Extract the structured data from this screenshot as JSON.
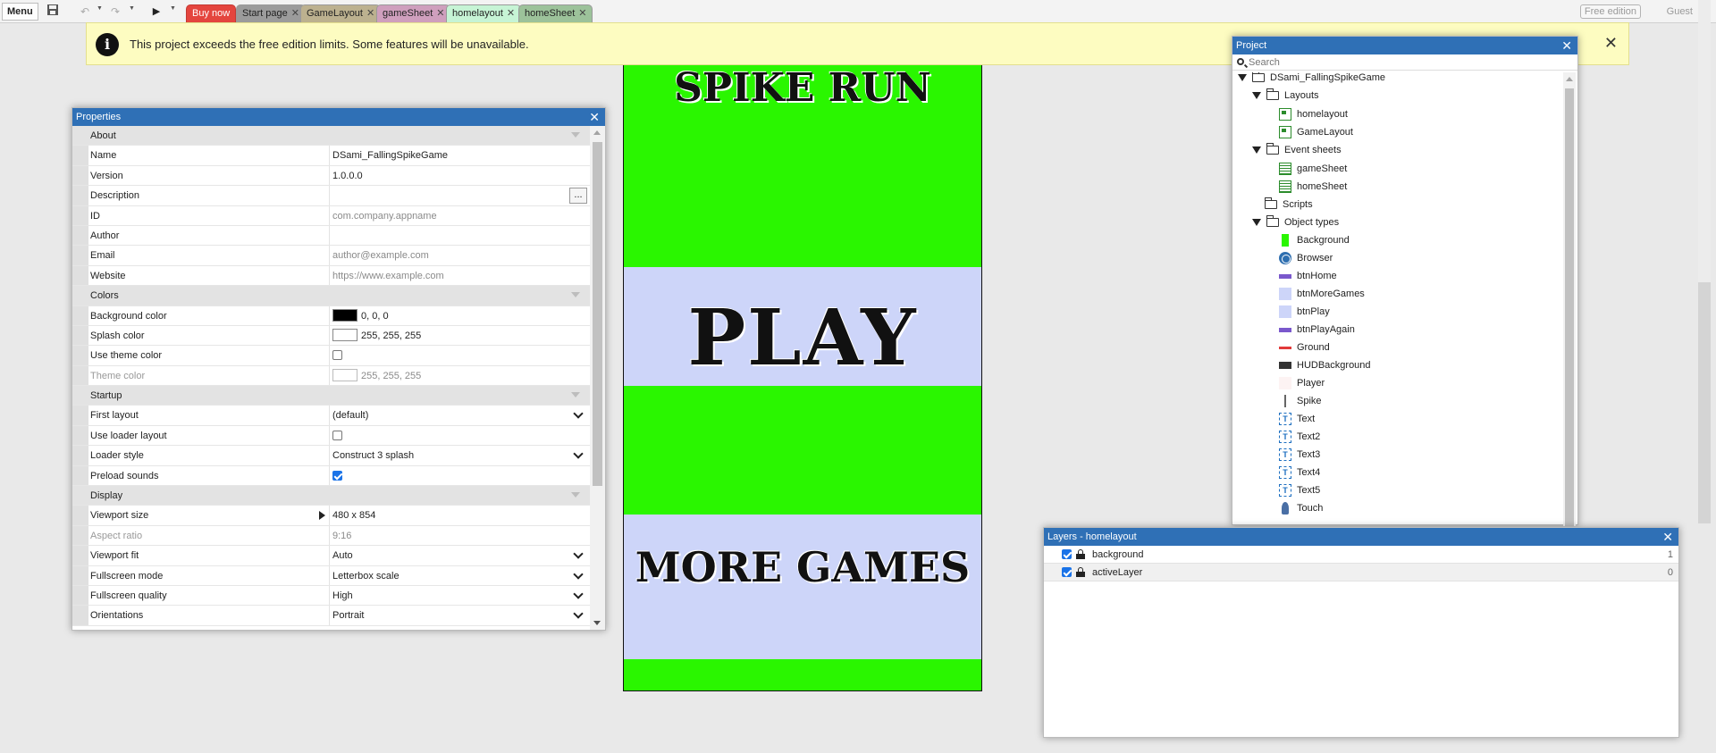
{
  "toolbar": {
    "menu_label": "Menu",
    "buy_now": "Buy now",
    "free_edition": "Free edition",
    "guest": "Guest"
  },
  "tabs": [
    {
      "label": "Start page",
      "bg": "#9b9b9b"
    },
    {
      "label": "GameLayout",
      "bg": "#bcb18f"
    },
    {
      "label": "gameSheet",
      "bg": "#cf9fbd"
    },
    {
      "label": "homelayout",
      "bg": "#c6f4d5"
    },
    {
      "label": "homeSheet",
      "bg": "#9cc29a"
    }
  ],
  "banner": {
    "text": "This project exceeds the free edition limits. Some features will be unavailable."
  },
  "canvas": {
    "title": "SPIKE RUN",
    "play": "PLAY",
    "more_games": "MORE GAMES",
    "green": "#2af600",
    "band": "#cdd5f9"
  },
  "properties": {
    "title": "Properties",
    "about": "About",
    "name_label": "Name",
    "name_value": "DSami_FallingSpikeGame",
    "version_label": "Version",
    "version_value": "1.0.0.0",
    "description_label": "Description",
    "description_button": "...",
    "id_label": "ID",
    "id_placeholder": "com.company.appname",
    "author_label": "Author",
    "email_label": "Email",
    "email_placeholder": "author@example.com",
    "website_label": "Website",
    "website_placeholder": "https://www.example.com",
    "colors": "Colors",
    "bg_color_label": "Background color",
    "bg_color_value": "0, 0, 0",
    "splash_color_label": "Splash color",
    "splash_color_value": "255, 255, 255",
    "use_theme_label": "Use theme color",
    "theme_color_label": "Theme color",
    "theme_color_value": "255, 255, 255",
    "startup": "Startup",
    "first_layout_label": "First layout",
    "first_layout_value": "(default)",
    "use_loader_label": "Use loader layout",
    "loader_style_label": "Loader style",
    "loader_style_value": "Construct 3 splash",
    "preload_label": "Preload sounds",
    "display": "Display",
    "viewport_size_label": "Viewport size",
    "viewport_size_value": "480 x 854",
    "aspect_label": "Aspect ratio",
    "aspect_value": "9:16",
    "viewport_fit_label": "Viewport fit",
    "viewport_fit_value": "Auto",
    "fullscreen_mode_label": "Fullscreen mode",
    "fullscreen_mode_value": "Letterbox scale",
    "fullscreen_quality_label": "Fullscreen quality",
    "fullscreen_quality_value": "High",
    "orientations_label": "Orientations",
    "orientations_value": "Portrait"
  },
  "project": {
    "title": "Project",
    "search_placeholder": "Search",
    "root": "DSami_FallingSpikeGame",
    "layouts": "Layouts",
    "layout_items": [
      "homelayout",
      "GameLayout"
    ],
    "event_sheets": "Event sheets",
    "sheet_items": [
      "gameSheet",
      "homeSheet"
    ],
    "scripts": "Scripts",
    "object_types": "Object types",
    "objects": [
      {
        "name": "Background",
        "icon": "green-swatch-icon"
      },
      {
        "name": "Browser",
        "icon": "globe-icon"
      },
      {
        "name": "btnHome",
        "icon": "purple-bar-icon"
      },
      {
        "name": "btnMoreGames",
        "icon": "lavender-square-icon"
      },
      {
        "name": "btnPlay",
        "icon": "lavender-square-icon"
      },
      {
        "name": "btnPlayAgain",
        "icon": "purple-bar-icon"
      },
      {
        "name": "Ground",
        "icon": "red-line-icon"
      },
      {
        "name": "HUDBackground",
        "icon": "dark-bar-icon"
      },
      {
        "name": "Player",
        "icon": "pale-square-icon"
      },
      {
        "name": "Spike",
        "icon": "vertical-line-icon"
      },
      {
        "name": "Text",
        "icon": "text-object-icon"
      },
      {
        "name": "Text2",
        "icon": "text-object-icon"
      },
      {
        "name": "Text3",
        "icon": "text-object-icon"
      },
      {
        "name": "Text4",
        "icon": "text-object-icon"
      },
      {
        "name": "Text5",
        "icon": "text-object-icon"
      },
      {
        "name": "Touch",
        "icon": "touch-icon"
      }
    ]
  },
  "layers": {
    "title": "Layers - homelayout",
    "items": [
      {
        "name": "background",
        "index": "1"
      },
      {
        "name": "activeLayer",
        "index": "0"
      }
    ]
  }
}
